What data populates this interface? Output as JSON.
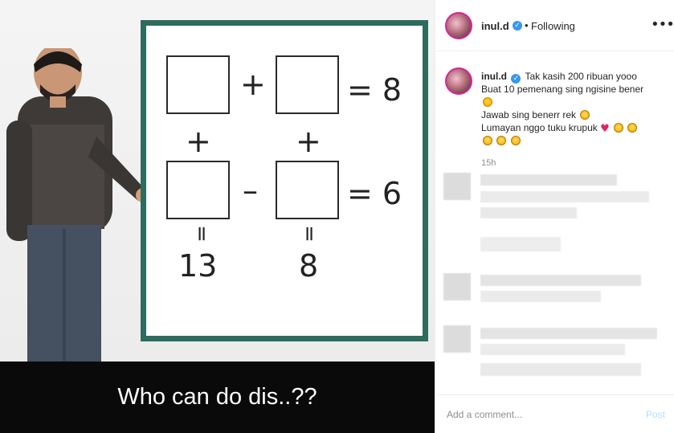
{
  "media": {
    "caption": "Who can do dis..??",
    "puzzle": {
      "row1_plus": "+",
      "row1_result": "= 8",
      "row2_minus": "–",
      "row2_result": "= 6",
      "plus_left": "+",
      "plus_right": "+",
      "eq_left": "=",
      "eq_right": "=",
      "col_left_result": "13",
      "col_right_result": "8"
    }
  },
  "header": {
    "username": "inul.d",
    "separator": "•",
    "follow_state": "Following",
    "more_icon": "more-horizontal-icon"
  },
  "caption": {
    "username": "inul.d",
    "line1": "Tak kasih 200 ribuan yooo",
    "line2": "Buat 10 pemenang sing ngisine bener",
    "line4": "Jawab sing benerr rek",
    "line5": "Lumayan nggo tuku krupuk",
    "time": "15h"
  },
  "footer": {
    "placeholder": "Add a comment...",
    "post_label": "Post"
  },
  "colors": {
    "board_border": "#2e6c5f",
    "verified_badge": "#3897f0",
    "post_disabled": "#b2dffc",
    "heart": "#e0245e"
  }
}
